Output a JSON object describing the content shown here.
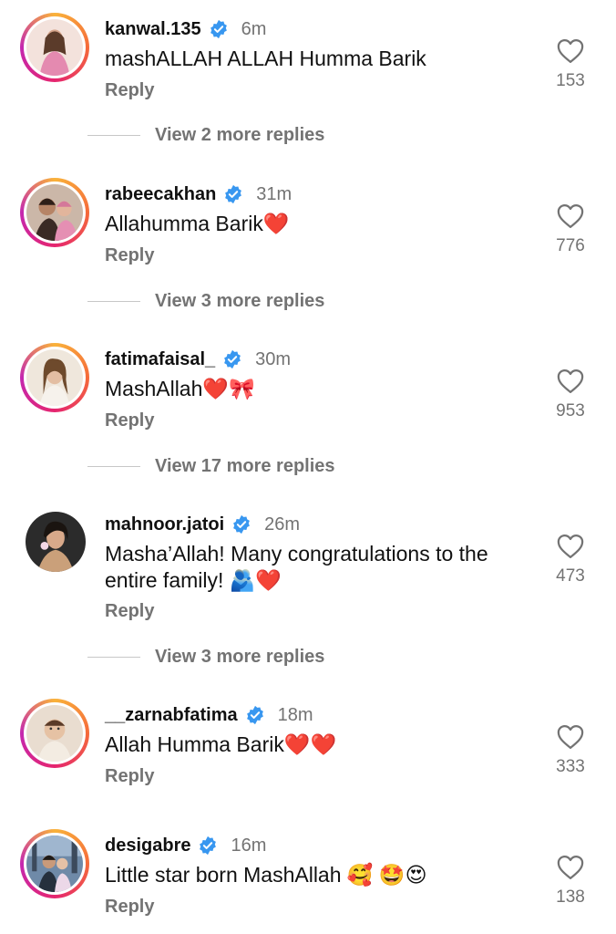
{
  "comments": [
    {
      "username": "kanwal.135",
      "time": "6m",
      "text": "mashALLAH ALLAH Humma Barik",
      "reply_label": "Reply",
      "likes": "153",
      "view_more": "View 2 more replies",
      "avatar_ring": true
    },
    {
      "username": "rabeecakhan",
      "time": "31m",
      "text": "Allahumma Barik❤️",
      "reply_label": "Reply",
      "likes": "776",
      "view_more": "View 3 more replies",
      "avatar_ring": true
    },
    {
      "username": "fatimafaisal_",
      "time": "30m",
      "text": "MashAllah❤️🎀",
      "reply_label": "Reply",
      "likes": "953",
      "view_more": "View 17 more replies",
      "avatar_ring": true
    },
    {
      "username": "mahnoor.jatoi",
      "time": "26m",
      "text": "Masha’Allah! Many congratulations to the entire family! 🫂❤️",
      "reply_label": "Reply",
      "likes": "473",
      "view_more": "View 3 more replies",
      "avatar_ring": false
    },
    {
      "username": "__zarnabfatima",
      "time": "18m",
      "text": "Allah Humma Barik❤️❤️",
      "reply_label": "Reply",
      "likes": "333",
      "avatar_ring": true
    },
    {
      "username": "desigabre",
      "time": "16m",
      "text": "Little star born MashAllah 🥰 🤩😍",
      "reply_label": "Reply",
      "likes": "138",
      "avatar_ring": true
    }
  ],
  "colors": {
    "verified_badge": "#3897f0",
    "muted_text": "#737373",
    "heart_emoji": "#e8212e"
  }
}
